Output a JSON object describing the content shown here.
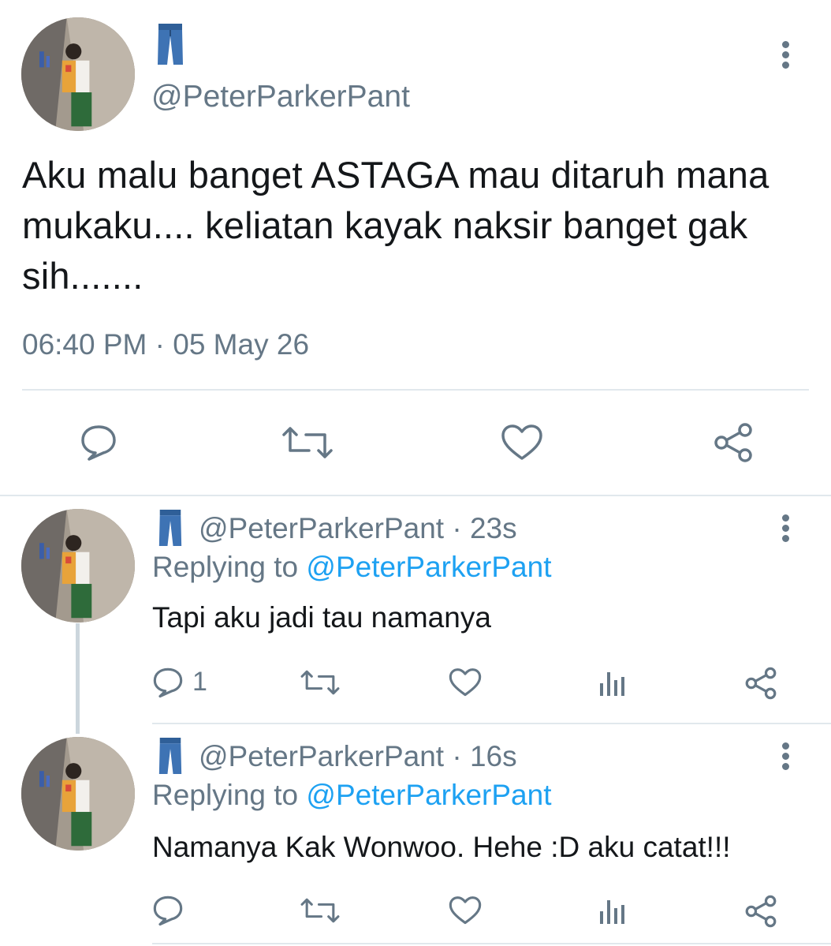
{
  "main_tweet": {
    "display_name_emoji": "jeans-emoji",
    "handle": "@PeterParkerPant",
    "text": "Aku malu banget ASTAGA mau ditaruh mana mukaku.... keliatan kayak naksir banget gak sih.......",
    "timestamp": "06:40 PM · 05 May 26"
  },
  "replies": [
    {
      "handle_time": "@PeterParkerPant · 23s",
      "replying_prefix": "Replying to ",
      "replying_handle": "@PeterParkerPant",
      "text": "Tapi aku jadi tau namanya",
      "reply_count": "1"
    },
    {
      "handle_time": "@PeterParkerPant · 16s",
      "replying_prefix": "Replying to ",
      "replying_handle": "@PeterParkerPant",
      "text": "Namanya Kak Wonwoo. Hehe :D aku catat!!!",
      "reply_count": ""
    }
  ],
  "colors": {
    "accent": "#1da1f2",
    "muted": "#657786",
    "text": "#14171a",
    "divider": "#e1e8ed"
  },
  "icons": [
    "reply-icon",
    "retweet-icon",
    "like-icon",
    "analytics-icon",
    "share-icon",
    "more-icon",
    "jeans-emoji"
  ]
}
